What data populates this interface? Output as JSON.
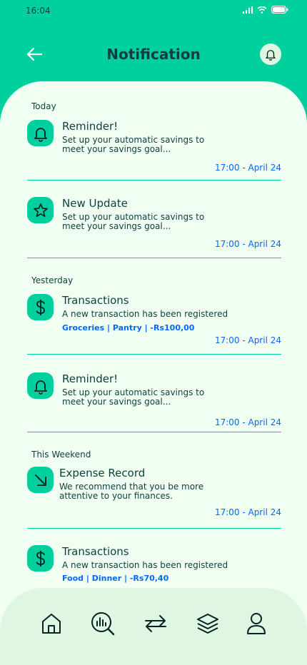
{
  "status": {
    "time": "16:04"
  },
  "header": {
    "title": "Notification"
  },
  "sections": {
    "today": "Today",
    "yesterday": "Yesterday",
    "weekend": "This Weekend"
  },
  "notifications": [
    {
      "icon": "bell-icon",
      "title": "Reminder!",
      "desc_line1": "Set up your automatic savings to",
      "desc_line2": "meet your savings goal...",
      "time": "17:00 - April 24"
    },
    {
      "icon": "star-icon",
      "title": "New Update",
      "desc_line1": "Set up your automatic savings to",
      "desc_line2": "meet your savings goal...",
      "time": "17:00 - April 24"
    },
    {
      "icon": "dollar-icon",
      "title": "Transactions",
      "desc_line1": "A new transaction has been registered",
      "tags": "Groceries |  Pantry  |  -Rs100,00",
      "time": "17:00 - April 24"
    },
    {
      "icon": "bell-icon",
      "title": "Reminder!",
      "desc_line1": "Set up your automatic savings to",
      "desc_line2": "meet your savings goal...",
      "time": "17:00 - April 24"
    },
    {
      "icon": "arrow-down-right-icon",
      "title": "Expense Record",
      "desc_line1": "We recommend that you be more",
      "desc_line2": "attentive to your finances.",
      "time": "17:00 - April 24"
    },
    {
      "icon": "dollar-icon",
      "title": "Transactions",
      "desc_line1": "A new transaction has been registered",
      "tags": "Food |  Dinner  |  -Rs70,40"
    }
  ],
  "nav": [
    "home-icon",
    "analysis-icon",
    "transfer-icon",
    "layers-icon",
    "profile-icon"
  ]
}
